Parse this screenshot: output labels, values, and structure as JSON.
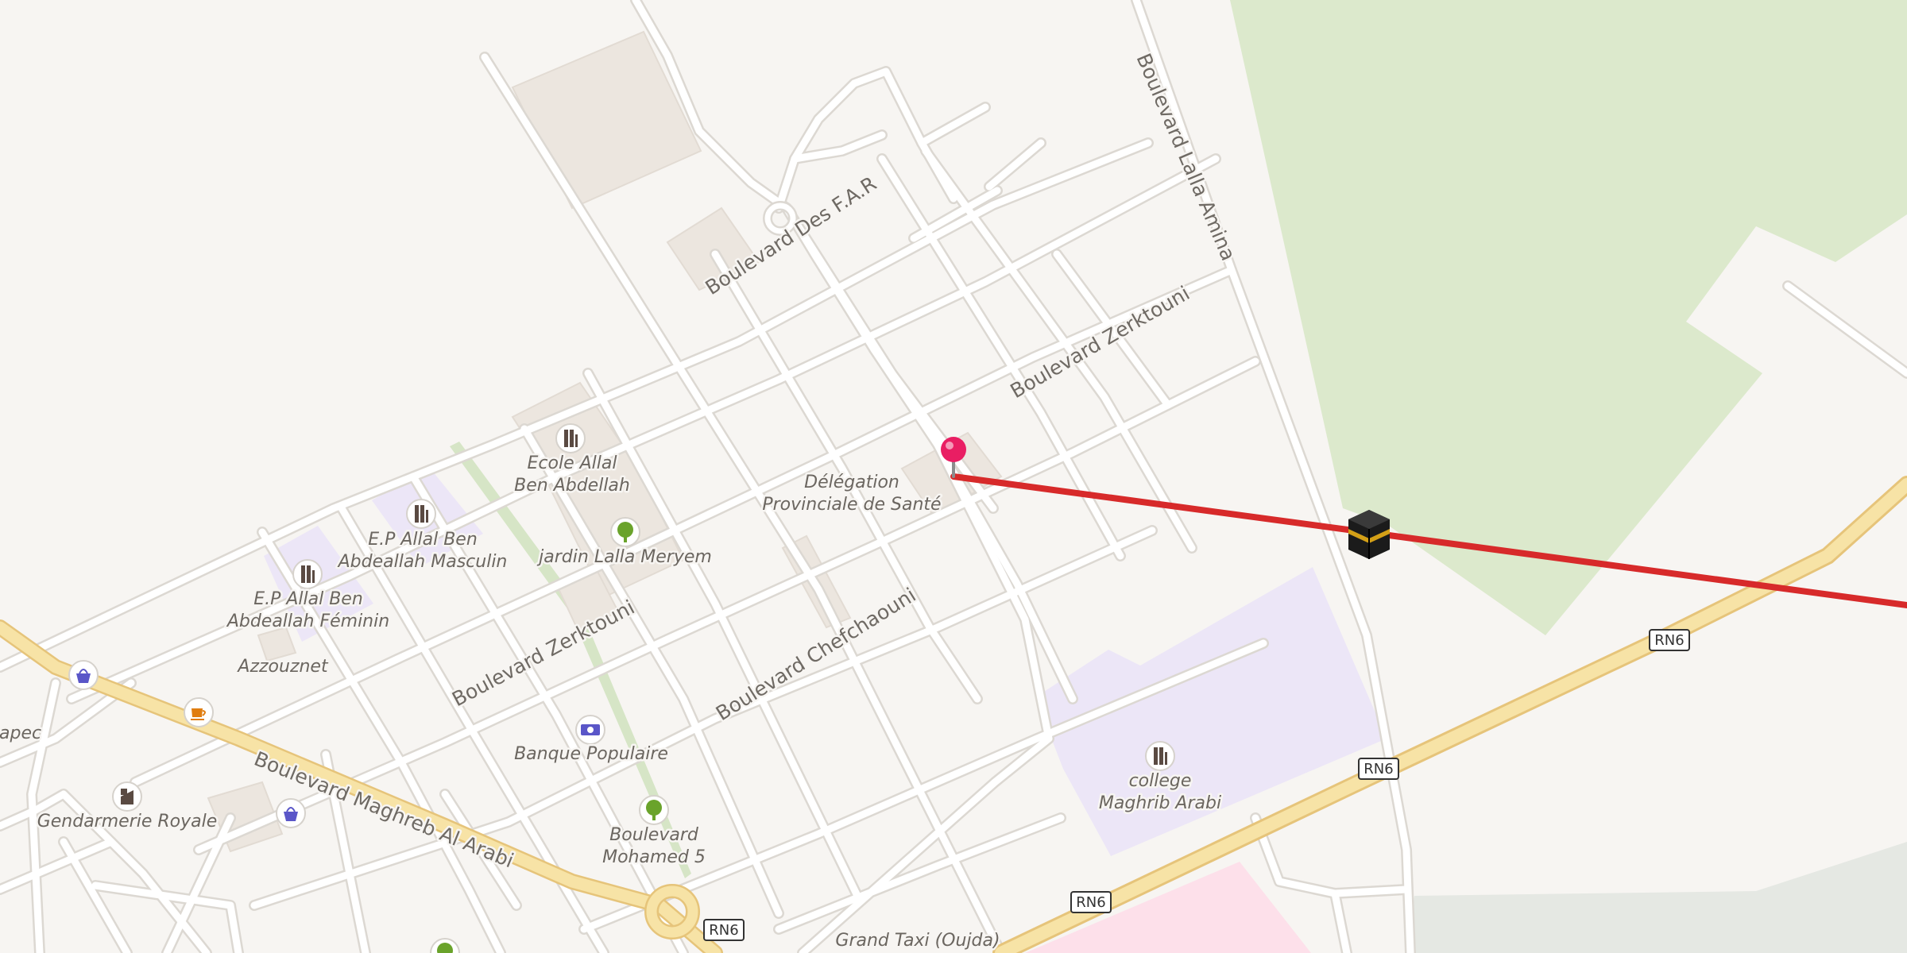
{
  "map": {
    "route": {
      "color": "#d72a2a"
    },
    "markers": {
      "pin": {
        "color": "#e91e63",
        "icon": "location-pin-icon"
      },
      "kaaba": {
        "icon": "kaaba-icon"
      }
    },
    "roads": {
      "far": "Boulevard Des F.A.R",
      "lalla_amina": "Boulevard Lalla Amina",
      "zerktouni_upper": "Boulevard Zerktouni",
      "zerktouni_lower": "Boulevard Zerktouni",
      "chefchaouni": "Boulevard Chefchaouni",
      "maghreb": "Boulevard Maghreb Al Arabi",
      "rn6_a": "RN6",
      "rn6_b": "RN6",
      "rn6_c": "RN6",
      "rn6_d": "RN6"
    },
    "pois": {
      "ecole_l1": "Ecole Allal",
      "ecole_l2": "Ben Abdellah",
      "delegation_l1": "Délégation",
      "delegation_l2": "Provinciale de Santé",
      "ep_masc_l1": "E.P Allal Ben",
      "ep_masc_l2": "Abdeallah Masculin",
      "jardin": "jardin Lalla Meryem",
      "ep_fem_l1": "E.P Allal Ben",
      "ep_fem_l2": "Abdeallah Féminin",
      "azzouznet": "Azzouznet",
      "anapec": "Anapec",
      "banque": "Banque Populaire",
      "gendarmerie": "Gendarmerie Royale",
      "bd_m5_l1": "Boulevard",
      "bd_m5_l2": "Mohamed 5",
      "college_l1": "college",
      "college_l2": "Maghrib Arabi",
      "grand_taxi": "Grand Taxi (Oujda)"
    },
    "colors": {
      "background": "#f7f5f2",
      "park": "#dce9cc",
      "school": "#ece6f7",
      "pink_zone": "#fde0ea",
      "highway": "#f7e3a6",
      "road": "#ffffff",
      "road_casing": "#dcd8d2",
      "building": "#ece6df"
    }
  }
}
